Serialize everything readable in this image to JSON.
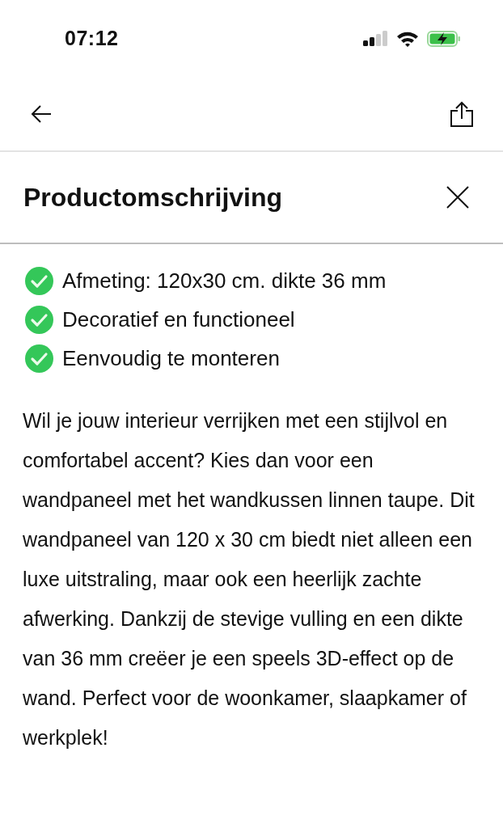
{
  "status_bar": {
    "time": "07:12"
  },
  "header": {
    "title": "Productomschrijving"
  },
  "features": [
    "Afmeting: 120x30 cm. dikte 36 mm",
    "Decoratief en functioneel",
    "Eenvoudig te monteren"
  ],
  "description": "Wil je jouw interieur verrijken met een stijlvol en comfortabel accent? Kies dan voor een wandpaneel met het wandkussen linnen taupe. Dit wandpaneel van 120 x 30 cm biedt niet alleen een luxe uitstraling, maar ook een heerlijk zachte afwerking. Dankzij de stevige vulling en een dikte van 36 mm creëer je een speels 3D-effect op de wand. Perfect voor de woonkamer, slaapkamer of werkplek!"
}
